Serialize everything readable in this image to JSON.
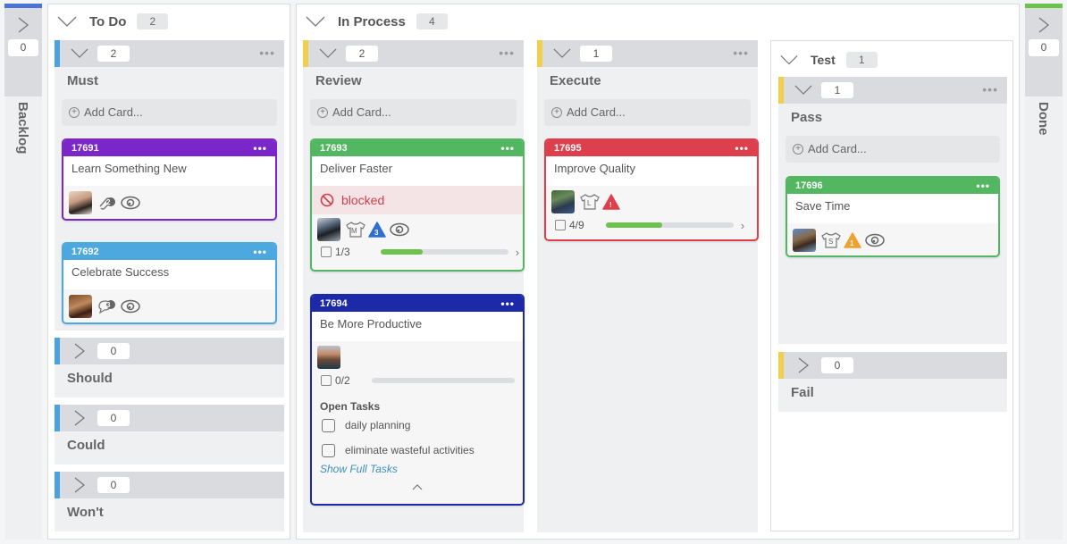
{
  "colors": {
    "blue_lane": "#4aa3e0",
    "yellow_lane": "#f2cf4a",
    "backlog_top": "#4a73d6",
    "done_top": "#6cc24a",
    "purple_card": "#7b26c9",
    "lightblue_card": "#4ea8e0",
    "green_card": "#52b760",
    "darkblue_card": "#1c2aa8",
    "red_card": "#dd3f4c",
    "progress_fill": "#6cc24a",
    "blocked_text": "#d63c48",
    "link": "#3c8fc0"
  },
  "backlog": {
    "label": "Backlog",
    "count": "0"
  },
  "done": {
    "label": "Done",
    "count": "0"
  },
  "lanes": {
    "todo": {
      "title": "To Do",
      "count": "2",
      "sublanes": {
        "must": {
          "title": "Must",
          "count": "2",
          "add_label": "Add Card..."
        },
        "should": {
          "title": "Should",
          "count": "0"
        },
        "could": {
          "title": "Could",
          "count": "0"
        },
        "wont": {
          "title": "Won't",
          "count": "0"
        }
      }
    },
    "inprocess": {
      "title": "In Process",
      "count": "4",
      "sublanes": {
        "review": {
          "title": "Review",
          "count": "2",
          "add_label": "Add Card..."
        },
        "execute": {
          "title": "Execute",
          "count": "1",
          "add_label": "Add Card..."
        },
        "test": {
          "title": "Test",
          "count": "1",
          "sublanes": {
            "pass": {
              "title": "Pass",
              "count": "1",
              "add_label": "Add Card..."
            },
            "fail": {
              "title": "Fail",
              "count": "0"
            }
          }
        }
      }
    }
  },
  "cards": {
    "c17691": {
      "id": "17691",
      "title": "Learn Something New",
      "attachments": "2"
    },
    "c17692": {
      "id": "17692",
      "title": "Celebrate Success",
      "comments": "3"
    },
    "c17693": {
      "id": "17693",
      "title": "Deliver Faster",
      "blocked_label": "blocked",
      "size": "M",
      "priority": "3",
      "progress_label": "1/3",
      "progress": 0.333
    },
    "c17694": {
      "id": "17694",
      "title": "Be More Productive",
      "progress_label": "0/2",
      "progress": 0,
      "tasks_heading": "Open Tasks",
      "tasks": [
        "daily planning",
        "eliminate wasteful activities"
      ],
      "show_full_label": "Show Full Tasks"
    },
    "c17695": {
      "id": "17695",
      "title": "Improve Quality",
      "size": "L",
      "priority": "!",
      "progress_label": "4/9",
      "progress": 0.444
    },
    "c17696": {
      "id": "17696",
      "title": "Save Time",
      "size": "S",
      "priority": "1"
    }
  },
  "more_glyph": "•••"
}
